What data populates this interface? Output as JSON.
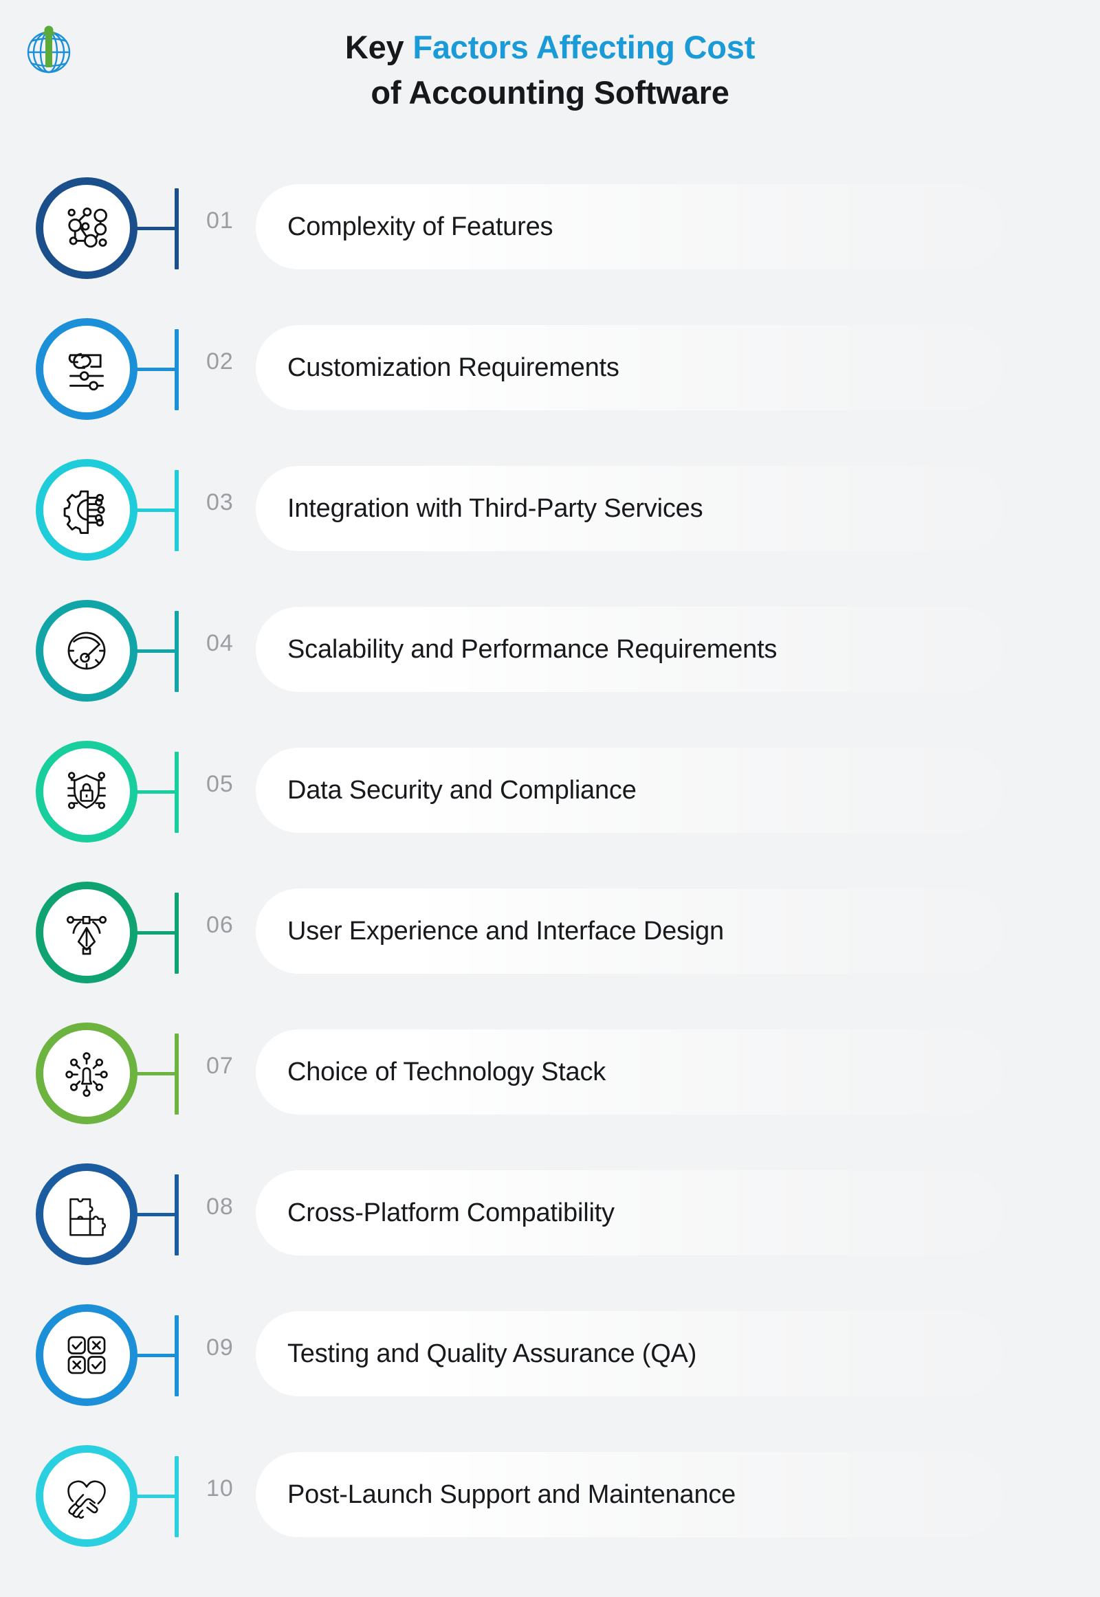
{
  "header": {
    "logo_name": "globe-i-logo",
    "title_line1_plain": "Key ",
    "title_line1_accent": "Factors Affecting Cost",
    "title_line2": "of Accounting Software",
    "accent_color": "#1b9ad8",
    "text_color": "#16181c"
  },
  "background_color": "#f2f3f4",
  "items": [
    {
      "number": "01",
      "label": "Complexity of Features",
      "color": "#1B4F8C",
      "icon": "network-nodes-icon"
    },
    {
      "number": "02",
      "label": "Customization Requirements",
      "color": "#1B8FD8",
      "icon": "hand-sliders-icon"
    },
    {
      "number": "03",
      "label": "Integration with Third-Party Services",
      "color": "#1ECDD9",
      "icon": "gear-circuit-icon"
    },
    {
      "number": "04",
      "label": "Scalability and Performance Requirements",
      "color": "#12A5A8",
      "icon": "speedometer-icon"
    },
    {
      "number": "05",
      "label": "Data Security and Compliance",
      "color": "#18CE9C",
      "icon": "shield-lock-circuit-icon"
    },
    {
      "number": "06",
      "label": "User Experience and Interface Design",
      "color": "#0FA372",
      "icon": "pen-tool-icon"
    },
    {
      "number": "07",
      "label": "Choice of Technology Stack",
      "color": "#6DB33F",
      "icon": "tech-stack-radial-icon"
    },
    {
      "number": "08",
      "label": "Cross-Platform Compatibility",
      "color": "#1B5CA0",
      "icon": "puzzle-pieces-icon"
    },
    {
      "number": "09",
      "label": "Testing and Quality Assurance (QA)",
      "color": "#1B8FD8",
      "icon": "qa-checkbox-grid-icon"
    },
    {
      "number": "10",
      "label": "Post-Launch Support and Maintenance",
      "color": "#2ACFE0",
      "icon": "handshake-heart-icon"
    }
  ]
}
